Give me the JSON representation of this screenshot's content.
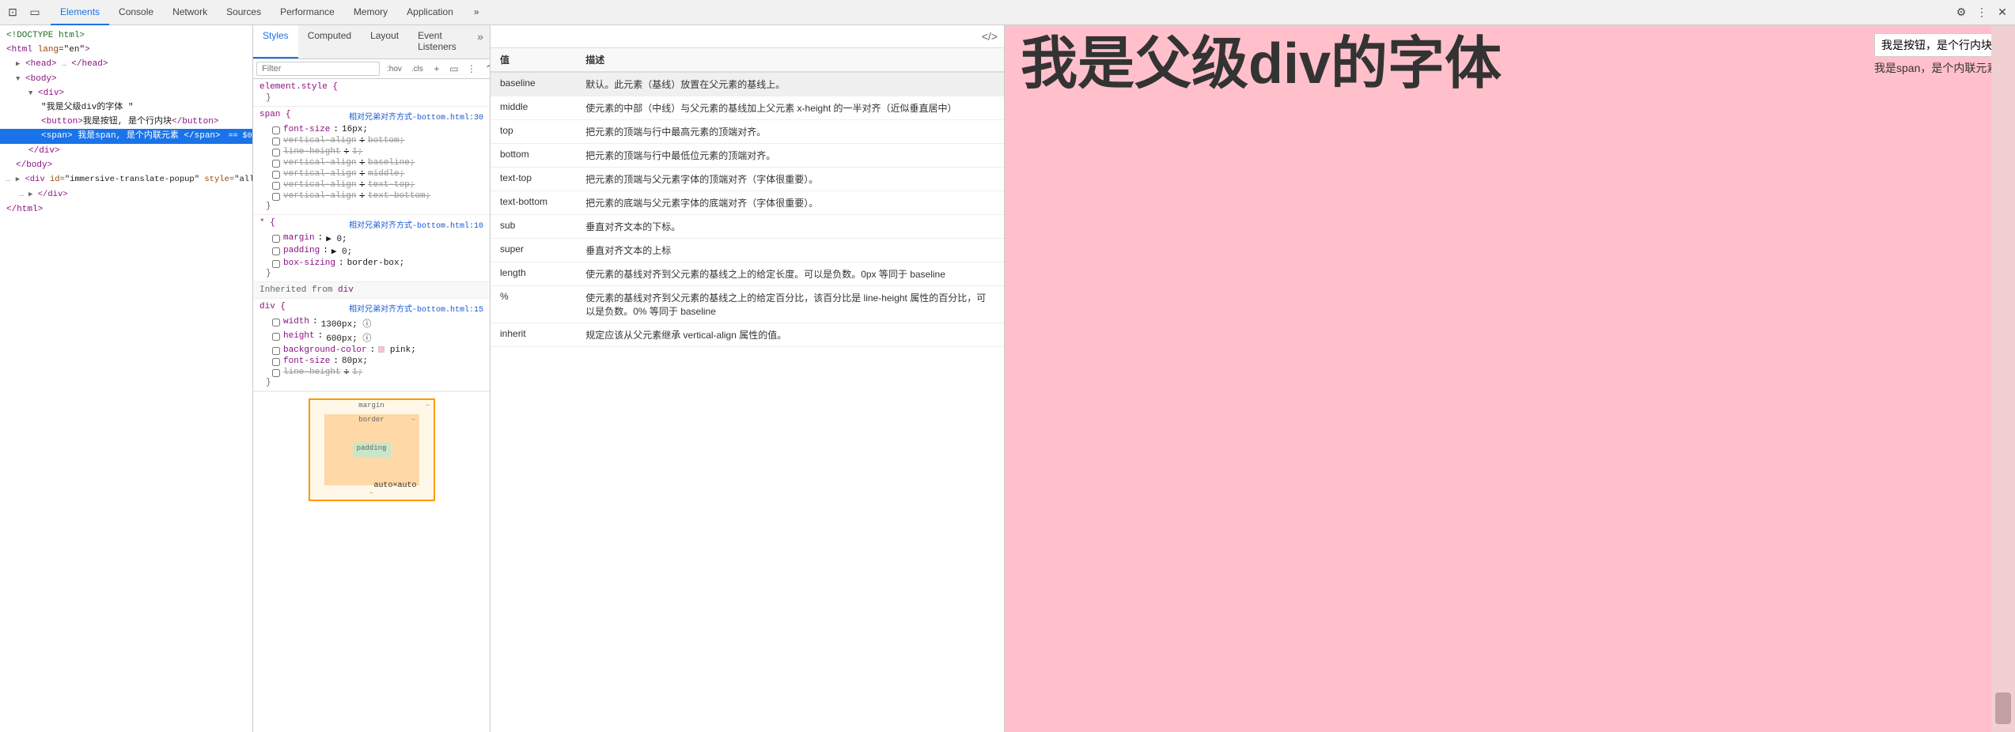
{
  "devtools": {
    "tabs": [
      {
        "id": "elements",
        "label": "Elements",
        "active": true
      },
      {
        "id": "console",
        "label": "Console",
        "active": false
      },
      {
        "id": "network",
        "label": "Network",
        "active": false
      },
      {
        "id": "sources",
        "label": "Sources",
        "active": false
      },
      {
        "id": "performance",
        "label": "Performance",
        "active": false
      },
      {
        "id": "memory",
        "label": "Memory",
        "active": false
      },
      {
        "id": "application",
        "label": "Application",
        "active": false
      }
    ],
    "more_tabs_icon": "»"
  },
  "styles_subtabs": [
    {
      "id": "styles",
      "label": "Styles",
      "active": true
    },
    {
      "id": "computed",
      "label": "Computed",
      "active": false
    },
    {
      "id": "layout",
      "label": "Layout",
      "active": false
    },
    {
      "id": "event-listeners",
      "label": "Event Listeners",
      "active": false
    }
  ],
  "filter": {
    "placeholder": "Filter",
    "hov_label": ":hov",
    "cls_label": ".cls"
  },
  "dom_tree": {
    "lines": [
      {
        "indent": 0,
        "content": "<!DOCTYPE html>",
        "type": "doctype"
      },
      {
        "indent": 0,
        "content": "<html lang=\"en\">",
        "type": "tag"
      },
      {
        "indent": 1,
        "content": "▶ <head> … </head>",
        "type": "collapsed"
      },
      {
        "indent": 1,
        "content": "▼ <body>",
        "type": "tag"
      },
      {
        "indent": 2,
        "content": "▼ <div>",
        "type": "tag"
      },
      {
        "indent": 3,
        "content": "我是父级div的字体 "
      },
      {
        "indent": 4,
        "content": "<button>我是按钮, 是个行内块</button>",
        "type": "tag"
      },
      {
        "indent": 4,
        "content": "<span> 我是span, 是个内联元素 </span> == $0",
        "type": "tag",
        "selected": true
      },
      {
        "indent": 3,
        "content": "</div>"
      },
      {
        "indent": 2,
        "content": "</body>"
      },
      {
        "indent": 1,
        "content": "▶ <div id=\"immersive-translate-popup\" style=\"all: initia\">"
      },
      {
        "indent": 2,
        "content": "… ▶ </div>"
      },
      {
        "indent": 0,
        "content": "</html>"
      }
    ]
  },
  "style_rules": [
    {
      "selector": "element.style {",
      "source": "",
      "props": []
    },
    {
      "selector": "span {",
      "source": "相对兄弟对齐方式-bottom.html:30",
      "props": [
        {
          "name": "font-size",
          "value": "16px;",
          "checked": false,
          "strikethrough": false
        },
        {
          "name": "vertical-align",
          "value": "bottom;",
          "checked": false,
          "strikethrough": true
        },
        {
          "name": "line-height",
          "value": "1;",
          "checked": false,
          "strikethrough": true
        },
        {
          "name": "vertical-align",
          "value": "baseline;",
          "checked": false,
          "strikethrough": true
        },
        {
          "name": "vertical-align",
          "value": "middle;",
          "checked": false,
          "strikethrough": true
        },
        {
          "name": "vertical-align",
          "value": "text-top;",
          "checked": false,
          "strikethrough": true
        },
        {
          "name": "vertical-align",
          "value": "text-bottom;",
          "checked": false,
          "strikethrough": true
        }
      ]
    },
    {
      "selector": "* {",
      "source": "相对兄弟对齐方式-bottom.html:10",
      "props": [
        {
          "name": "margin",
          "value": "▶ 0;",
          "checked": false,
          "strikethrough": false
        },
        {
          "name": "padding",
          "value": "▶ 0;",
          "checked": false,
          "strikethrough": false
        },
        {
          "name": "box-sizing",
          "value": "border-box;",
          "checked": false,
          "strikethrough": false
        }
      ]
    },
    {
      "inherited": true,
      "from": "div",
      "selector": "div {",
      "source": "相对兄弟对齐方式-bottom.html:15",
      "props": [
        {
          "name": "width",
          "value": "1300px; ⓘ",
          "checked": false,
          "strikethrough": false
        },
        {
          "name": "height",
          "value": "600px; ⓘ",
          "checked": false,
          "strikethrough": false
        },
        {
          "name": "background-color",
          "value": "■ pink;",
          "checked": false,
          "strikethrough": false
        },
        {
          "name": "font-size",
          "value": "80px;",
          "checked": false,
          "strikethrough": false
        },
        {
          "name": "line-height",
          "value": "1;",
          "checked": false,
          "strikethrough": true
        }
      ]
    }
  ],
  "box_model": {
    "margin_label": "margin",
    "border_label": "border",
    "padding_label": "padding",
    "content_label": "auto×auto",
    "margin_dash": "–",
    "border_dash": "–",
    "padding_dash": "–",
    "top_dash": "–",
    "bottom_dash": "–"
  },
  "tooltip_table": {
    "header_col1": "值",
    "header_col2": "描述",
    "rows": [
      {
        "value": "baseline",
        "desc": "默认。此元素（基线）放置在父元素的基线上。"
      },
      {
        "value": "middle",
        "desc": "使元素的中部（中线）与父元素的基线加上父元素 x-height 的一半对齐（近似垂直居中）"
      },
      {
        "value": "top",
        "desc": "把元素的顶端与行中最高元素的顶端对齐。"
      },
      {
        "value": "bottom",
        "desc": "把元素的顶端与行中最低位元素的顶端对齐。"
      },
      {
        "value": "text-top",
        "desc": "把元素的顶端与父元素字体的顶端对齐（字体很重要）。"
      },
      {
        "value": "text-bottom",
        "desc": "把元素的底端与父元素字体的底端对齐（字体很重要）。"
      },
      {
        "value": "sub",
        "desc": "垂直对齐文本的下标。"
      },
      {
        "value": "super",
        "desc": "垂直对齐文本的上标"
      },
      {
        "value": "length",
        "desc": "使元素的基线对齐到父元素的基线之上的给定长度。可以是负数。0px 等同于 baseline"
      },
      {
        "value": "%",
        "desc": "使元素的基线对齐到父元素的基线之上的给定百分比，该百分比是 line-height 属性的百分比，可以是负数。0% 等同于 baseline"
      },
      {
        "value": "inherit",
        "desc": "规定应该从父元素继承 vertical-align 属性的值。"
      }
    ]
  },
  "webpage": {
    "big_text": "我是父级div的字体",
    "button_text": "我是按钮，是个行内块",
    "span_text": "我是span，是个内联元素"
  }
}
